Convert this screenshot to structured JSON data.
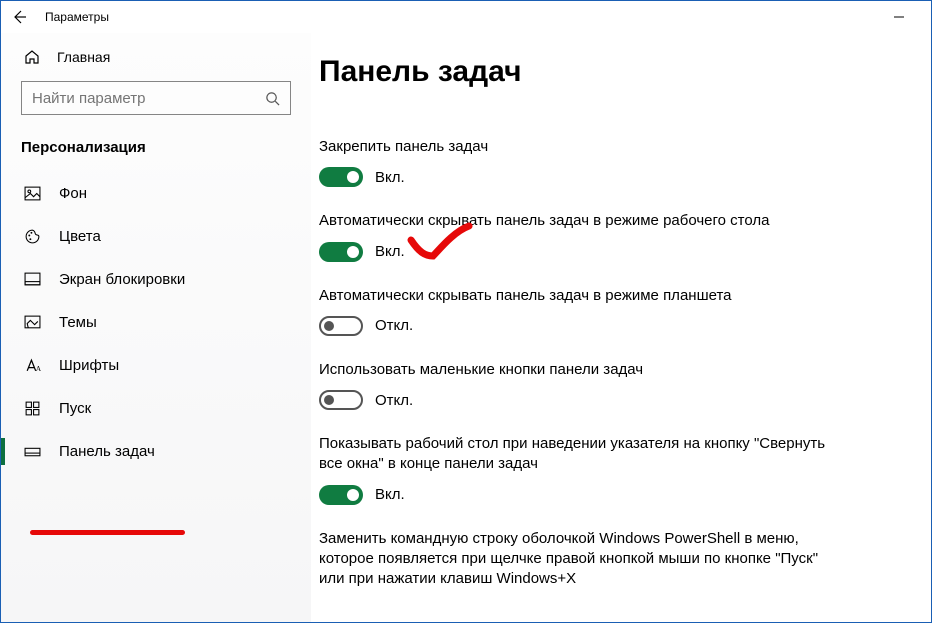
{
  "titlebar": {
    "app_title": "Параметры"
  },
  "sidebar": {
    "home": "Главная",
    "search_placeholder": "Найти параметр",
    "category": "Персонализация",
    "items": [
      {
        "label": "Фон"
      },
      {
        "label": "Цвета"
      },
      {
        "label": "Экран блокировки"
      },
      {
        "label": "Темы"
      },
      {
        "label": "Шрифты"
      },
      {
        "label": "Пуск"
      },
      {
        "label": "Панель задач"
      }
    ]
  },
  "main": {
    "title": "Панель задач",
    "state_on": "Вкл.",
    "state_off": "Откл.",
    "settings": [
      {
        "label": "Закрепить панель задач",
        "on": true
      },
      {
        "label": "Автоматически скрывать панель задач в режиме рабочего стола",
        "on": true
      },
      {
        "label": "Автоматически скрывать панель задач в режиме планшета",
        "on": false
      },
      {
        "label": "Использовать маленькие кнопки панели задач",
        "on": false
      },
      {
        "label": "Показывать рабочий стол при наведении указателя на кнопку \"Свернуть все окна\" в конце панели задач",
        "on": true
      },
      {
        "label": "Заменить командную строку оболочкой Windows PowerShell в меню, которое появляется при щелчке правой кнопкой мыши по кнопке \"Пуск\" или при нажатии клавиш Windows+X",
        "on": null
      }
    ]
  }
}
